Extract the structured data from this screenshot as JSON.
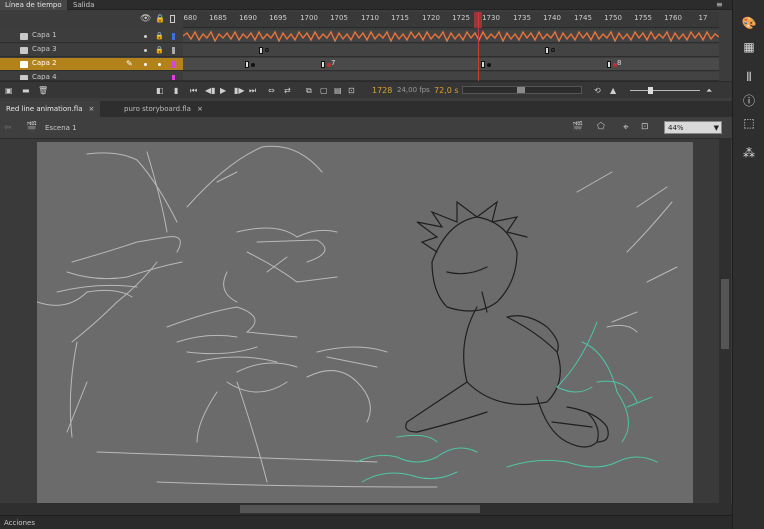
{
  "panels": {
    "timeline_tab": "Línea de tiempo",
    "output_tab": "Salida"
  },
  "ruler": {
    "ticks": [
      "1680",
      "1685",
      "1690",
      "1695",
      "1700",
      "1705",
      "1710",
      "1715",
      "1720",
      "1725",
      "1730",
      "1735",
      "1740",
      "1745",
      "1750",
      "1755",
      "1760",
      "17"
    ]
  },
  "layers": [
    {
      "name": "Capa 1",
      "color": "#3e6ee0"
    },
    {
      "name": "Capa 3",
      "color": "#aaaaaa"
    },
    {
      "name": "Capa 2",
      "color": "#e040e0"
    },
    {
      "name": "Capa 4",
      "color": "#e040e0"
    }
  ],
  "frames": {
    "label_7": "7",
    "label_8": "8"
  },
  "controls": {
    "current_frame": "1728",
    "fps": "24,00 fps",
    "time": "72,0 s"
  },
  "documents": [
    {
      "title": "Red line animation.fla"
    },
    {
      "title": "puro storyboard.fla"
    }
  ],
  "scene": {
    "name": "Escena 1",
    "zoom": "44%"
  },
  "bottom": {
    "actions_tab": "Acciones"
  },
  "right_panel_icons": [
    "palette-icon",
    "swatches-icon",
    "align-icon",
    "info-icon",
    "transform-icon",
    "color-icon"
  ]
}
